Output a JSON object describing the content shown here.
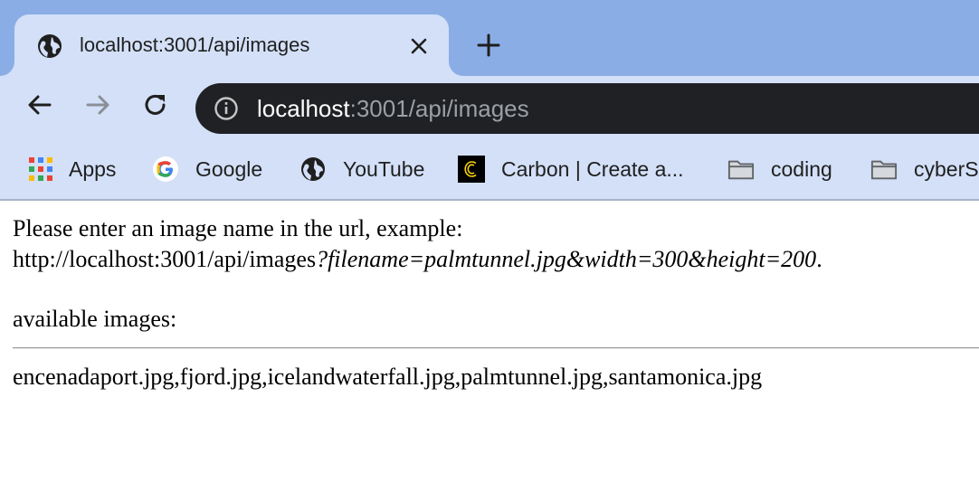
{
  "browser": {
    "tab": {
      "title": "localhost:3001/api/images",
      "favicon": "globe-icon",
      "close": "close-icon"
    },
    "new_tab": "plus-icon",
    "toolbar": {
      "back": "back-arrow-icon",
      "forward": "forward-arrow-icon",
      "reload": "reload-icon"
    },
    "omnibox": {
      "host": "localhost",
      "rest": ":3001/api/images",
      "info": "info-icon"
    },
    "colors": {
      "tabstrip": "#8aade6",
      "toolbar": "#d3e0f7",
      "omnibox": "#202124"
    },
    "bookmarks": [
      {
        "label": "Apps",
        "icon": "apps-grid-icon"
      },
      {
        "label": "Google",
        "icon": "google-icon"
      },
      {
        "label": "YouTube",
        "icon": "globe-icon"
      },
      {
        "label": "Carbon | Create a...",
        "icon": "carbon-icon"
      },
      {
        "label": "coding",
        "icon": "folder-icon"
      },
      {
        "label": "cyberS",
        "icon": "folder-icon"
      }
    ]
  },
  "page": {
    "intro": "Please enter an image name in the url, example:",
    "example_url_base": "http://localhost:3001/api/images",
    "example_url_query": "?filename=palmtunnel.jpg&width=300&height=200",
    "example_url_end": ".",
    "available_label": "available images:",
    "images_list": "encenadaport.jpg,fjord.jpg,icelandwaterfall.jpg,palmtunnel.jpg,santamonica.jpg"
  }
}
